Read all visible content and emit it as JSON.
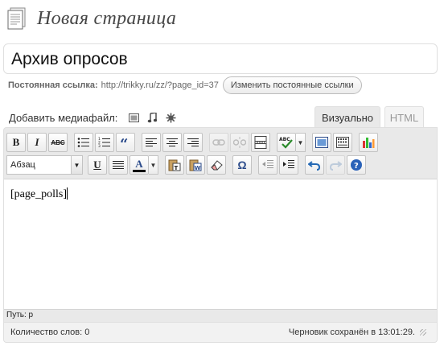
{
  "header": {
    "title": "Новая страница",
    "icon": "page-icon"
  },
  "title_field": {
    "value": "Архив опросов"
  },
  "permalink": {
    "label": "Постоянная ссылка:",
    "url": "http://trikky.ru/zz/?page_id=37",
    "button_label": "Изменить постоянные ссылки"
  },
  "media": {
    "label": "Добавить медиафайл:",
    "icons": [
      "image-icon",
      "audio-icon",
      "media-icon"
    ]
  },
  "tabs": {
    "visual": "Визуально",
    "html": "HTML",
    "active": "visual"
  },
  "toolbar": {
    "bold": "B",
    "italic": "I",
    "strikethrough": "ABC",
    "format_value": "Абзац",
    "underline": "U",
    "text_color": "A",
    "insert_char": "Ω",
    "spell_check": "ABC"
  },
  "editor": {
    "content": "[page_polls]"
  },
  "path": {
    "text": "Путь: p"
  },
  "status": {
    "word_count": "Количество слов: 0",
    "draft_saved": "Черновик сохранён в 13:01:29."
  },
  "colors": {
    "toolbar_bg": "#e9e9e9",
    "border": "#dfdfdf",
    "title_text": "#464646",
    "link_text": "#666666",
    "undo_blue": "#2469b5",
    "help_blue": "#2a62b8",
    "chart_colors": [
      "#d33",
      "#3b3",
      "#36c",
      "#fc3"
    ]
  }
}
